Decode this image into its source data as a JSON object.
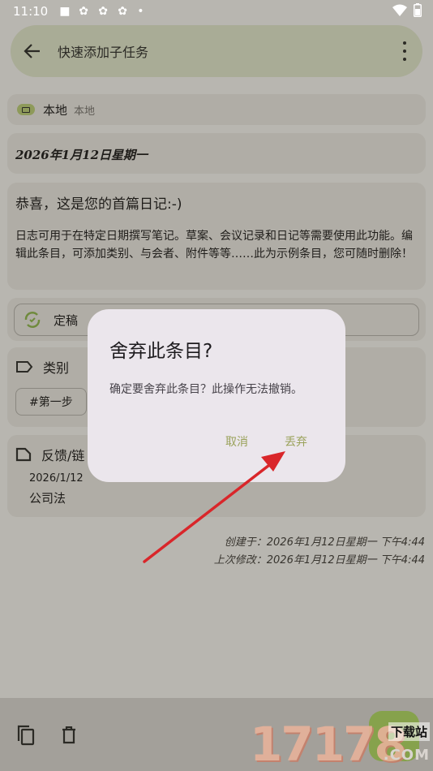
{
  "status": {
    "time": "11:10"
  },
  "appbar": {
    "title": "快速添加子任务"
  },
  "collection": {
    "name": "本地",
    "account": "本地"
  },
  "entry": {
    "date": "2026年1月12日星期一",
    "heading": "恭喜，这是您的首篇日记:-)",
    "body": "日志可用于在特定日期撰写笔记。草案、会议记录和日记等需要使用此功能。编辑此条目，可添加类别、与会者、附件等等……此为示例条目，您可随时删除！",
    "status_label": "定稿"
  },
  "categories": {
    "title": "类别",
    "tag": "#第一步"
  },
  "feedback": {
    "title": "反馈/链",
    "date": "2026/1/12",
    "note": "公司法"
  },
  "meta": {
    "created": "创建于：2026年1月12日星期一 下午4:44",
    "modified": "上次修改：2026年1月12日星期一 下午4:44"
  },
  "dialog": {
    "title": "舍弃此条目?",
    "message": "确定要舍弃此条目？此操作无法撤销。",
    "cancel": "取消",
    "discard": "丢弃"
  },
  "watermark": {
    "number": "17178",
    "site": "下载站",
    "domain": ".COM"
  },
  "colors": {
    "accent": "#9aa25a",
    "dialog_bg": "#ebe6ec",
    "arrow": "#d9262a"
  }
}
